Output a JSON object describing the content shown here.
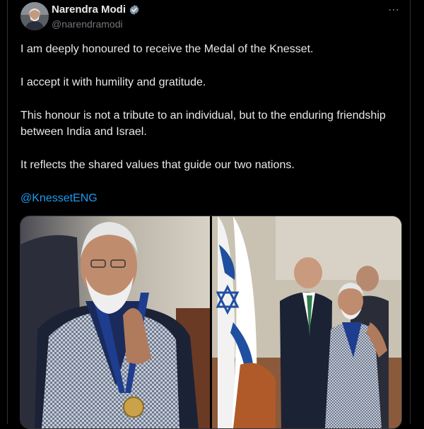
{
  "author": {
    "name": "Narendra Modi",
    "handle": "@narendramodi",
    "verified": true,
    "avatar_icon": "profile-photo"
  },
  "more_icon": "⋯",
  "post": {
    "paragraphs": [
      "I am deeply honoured to receive the Medal of the Knesset.",
      "I accept it with humility and gratitude.",
      "This honour is not a tribute to an individual, but to the enduring friendship between India and Israel.",
      "It reflects the shared values that guide our two nations."
    ],
    "mention": "@KnessetENG"
  },
  "media": {
    "count": 2,
    "items": [
      "photo-modi-namaste-medal",
      "photo-knesset-ceremony-israel-flag"
    ]
  },
  "colors": {
    "background": "#000000",
    "text": "#e7e9ea",
    "muted": "#71767b",
    "link": "#1d9bf0",
    "border": "#2f3336"
  }
}
